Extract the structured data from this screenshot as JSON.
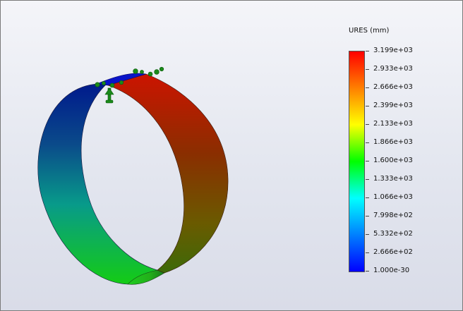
{
  "legend": {
    "title": "URES (mm)",
    "labels": [
      "3.199e+03",
      "2.933e+03",
      "2.666e+03",
      "2.399e+03",
      "2.133e+03",
      "1.866e+03",
      "1.600e+03",
      "1.333e+03",
      "1.066e+03",
      "7.998e+02",
      "5.332e+02",
      "2.666e+02",
      "1.000e-30"
    ]
  },
  "colors": {
    "max": "#ff0000",
    "mid": "#00ff00",
    "min": "#0000ff",
    "fixture": "#1a8a1a"
  },
  "icons": {
    "fixture_markers": "fixed-geometry-arrows"
  }
}
